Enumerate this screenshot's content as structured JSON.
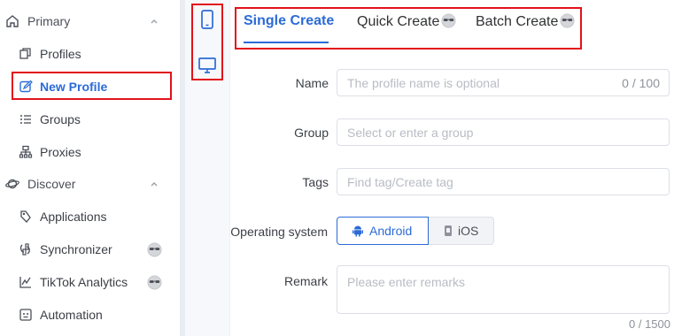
{
  "sidebar": {
    "groups": [
      {
        "label": "Primary",
        "icon": "home-icon",
        "items": [
          {
            "label": "Profiles",
            "icon": "profiles-icon"
          },
          {
            "label": "New Profile",
            "icon": "edit-icon",
            "active": true
          },
          {
            "label": "Groups",
            "icon": "list-icon"
          },
          {
            "label": "Proxies",
            "icon": "network-icon"
          }
        ]
      },
      {
        "label": "Discover",
        "icon": "planet-icon",
        "items": [
          {
            "label": "Applications",
            "icon": "puzzle-icon"
          },
          {
            "label": "Synchronizer",
            "icon": "sync-icon",
            "badge": "sunglasses-icon"
          },
          {
            "label": "TikTok Analytics",
            "icon": "chart-icon",
            "badge": "sunglasses-icon"
          },
          {
            "label": "Automation",
            "icon": "robot-icon"
          }
        ]
      }
    ]
  },
  "device_strip": {
    "mobile": "mobile-icon",
    "desktop": "desktop-icon"
  },
  "tabs": [
    {
      "label": "Single Create",
      "active": true
    },
    {
      "label": "Quick Create",
      "badge": "sunglasses-icon"
    },
    {
      "label": "Batch Create",
      "badge": "sunglasses-icon"
    }
  ],
  "form": {
    "name": {
      "label": "Name",
      "placeholder": "The profile name is optional",
      "counter": "0 / 100"
    },
    "group": {
      "label": "Group",
      "placeholder": "Select or enter a group"
    },
    "tags": {
      "label": "Tags",
      "placeholder": "Find tag/Create tag"
    },
    "os": {
      "label": "Operating system",
      "options": [
        "Android",
        "iOS"
      ],
      "selected": "Android"
    },
    "remark": {
      "label": "Remark",
      "placeholder": "Please enter remarks",
      "counter": "0 / 1500"
    }
  },
  "colors": {
    "accent": "#2b6bd6",
    "highlight_box": "#e2121b"
  }
}
